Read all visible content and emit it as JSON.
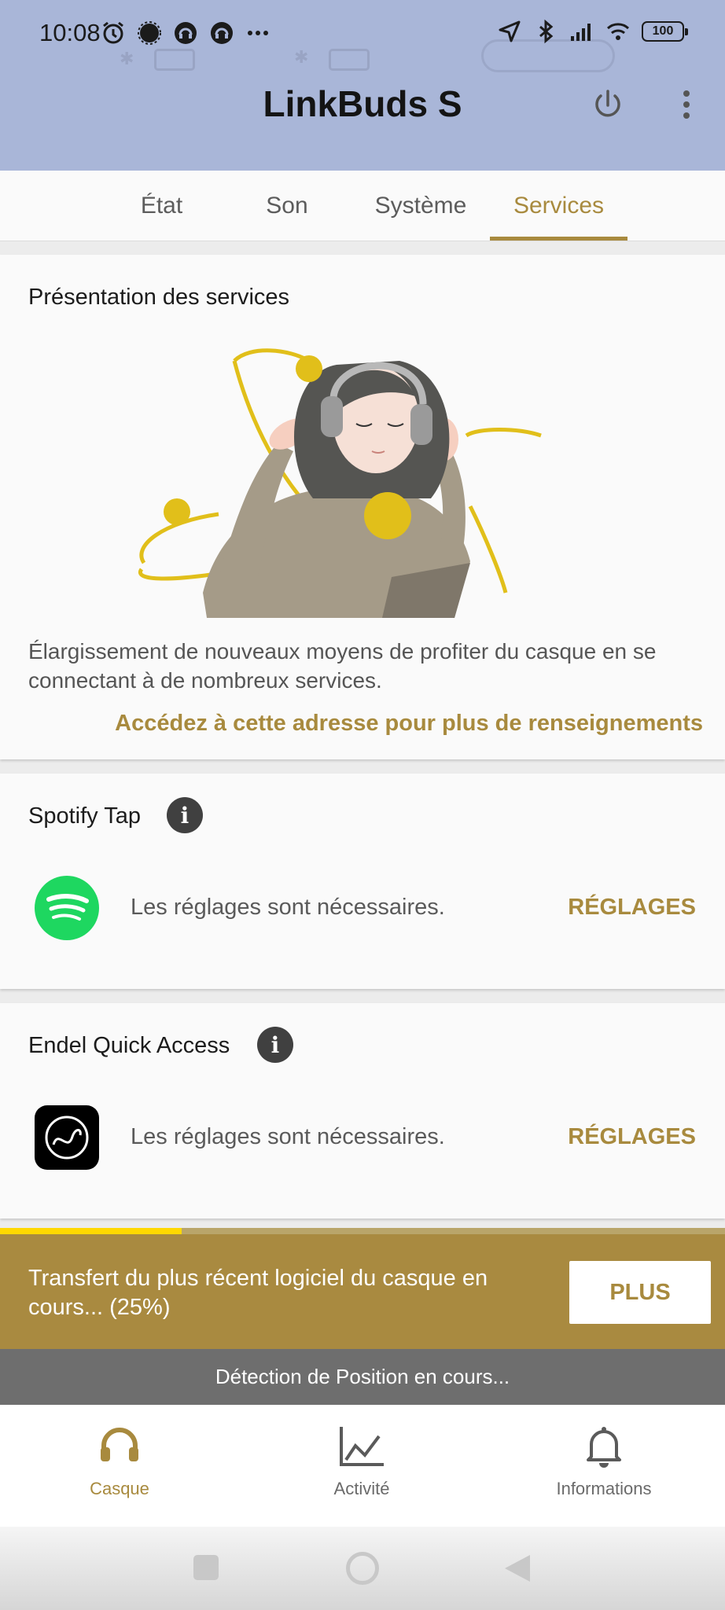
{
  "status_bar": {
    "time": "10:08",
    "battery": "100"
  },
  "header": {
    "title": "LinkBuds S"
  },
  "tabs": [
    {
      "label": "État"
    },
    {
      "label": "Son"
    },
    {
      "label": "Système"
    },
    {
      "label": "Services"
    }
  ],
  "active_tab": "Services",
  "overview": {
    "title": "Présentation des services",
    "description": "Élargissement de nouveaux moyens de profiter du casque en se connectant à de nombreux services.",
    "link": "Accédez à cette adresse pour plus de renseignements"
  },
  "spotify": {
    "title": "Spotify Tap",
    "status": "Les réglages sont nécessaires.",
    "action": "RÉGLAGES"
  },
  "endel": {
    "title": "Endel Quick Access",
    "status": "Les réglages sont nécessaires.",
    "action": "RÉGLAGES"
  },
  "update": {
    "text": "Transfert du plus récent logiciel du casque en cours... (25%)",
    "progress": 0.25,
    "button": "PLUS"
  },
  "detection": {
    "text": "Détection de Position en cours..."
  },
  "bottom_nav": [
    {
      "label": "Casque",
      "icon": "headphones-icon"
    },
    {
      "label": "Activité",
      "icon": "activity-chart-icon"
    },
    {
      "label": "Informations",
      "icon": "bell-icon"
    }
  ],
  "colors": {
    "accent": "#a88a3e",
    "header_bg": "#a9b6d8",
    "progress_fill": "#ffd800",
    "spotify_green": "#1ed760"
  }
}
